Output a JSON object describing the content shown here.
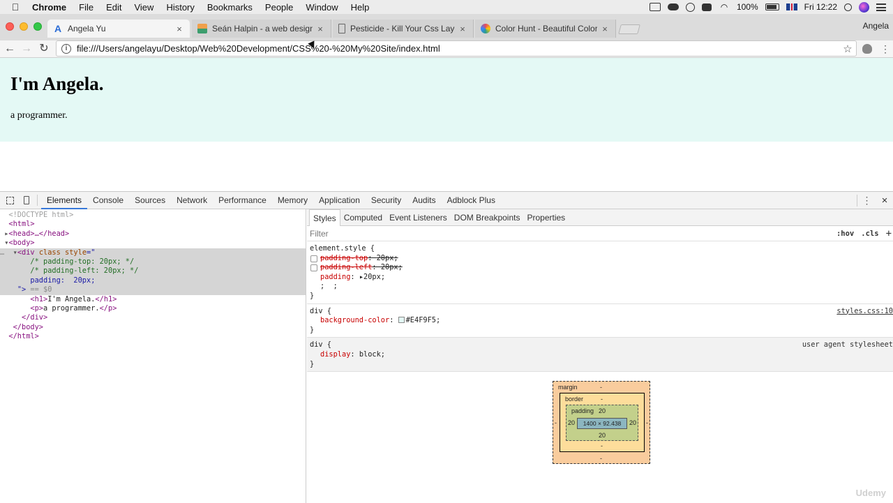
{
  "menubar": {
    "app": "Chrome",
    "items": [
      "File",
      "Edit",
      "View",
      "History",
      "Bookmarks",
      "People",
      "Window",
      "Help"
    ],
    "battery": "100%",
    "clock": "Fri 12:22"
  },
  "tabs": [
    {
      "title": "Angela Yu",
      "icon": "angela-favicon",
      "active": true
    },
    {
      "title": "Seán Halpin - a web designer a",
      "icon": "sean-favicon",
      "active": false
    },
    {
      "title": "Pesticide - Kill Your Css Layou",
      "icon": "page-icon",
      "active": false
    },
    {
      "title": "Color Hunt - Beautiful Color Pa",
      "icon": "colorhunt-favicon",
      "active": false
    }
  ],
  "profile": "Angela",
  "toolbar": {
    "url": "file:///Users/angelayu/Desktop/Web%20Development/CSS%20-%20My%20Site/index.html",
    "close_glyph": "×"
  },
  "page": {
    "heading": "I'm Angela.",
    "paragraph": "a programmer.",
    "bg_color": "#E4F9F5"
  },
  "devtools": {
    "tabs": [
      "Elements",
      "Console",
      "Sources",
      "Network",
      "Performance",
      "Memory",
      "Application",
      "Security",
      "Audits",
      "Adblock Plus"
    ],
    "active_tab": "Elements",
    "dom": {
      "doctype": "<!DOCTYPE html>",
      "html_open": "<html>",
      "head": "<head>…</head>",
      "body_open": "<body>",
      "div_open_tag": "<div",
      "div_attr_name": "class style",
      "div_attr_eq": "=\"",
      "comment1": "/* padding-top: 20px; */",
      "comment2": "/* padding-left: 20px; */",
      "style_line": "padding:  20px;",
      "close_quote": "\">",
      "dollar_zero": "== $0",
      "h1_open": "<h1>",
      "h1_text": "I'm Angela.",
      "h1_close": "</h1>",
      "p_open": "<p>",
      "p_text": "a programmer.",
      "p_close": "</p>",
      "div_close": "</div>",
      "body_close": "</body>",
      "html_close": "</html>"
    },
    "styles_tabs": [
      "Styles",
      "Computed",
      "Event Listeners",
      "DOM Breakpoints",
      "Properties"
    ],
    "filter_placeholder": "Filter",
    "filter_hov": ":hov",
    "filter_cls": ".cls",
    "filter_plus": "+",
    "rules": {
      "element_style": {
        "selector": "element.style {",
        "p1_name": "padding-top",
        "p1_val": "20px;",
        "p2_name": "padding-left",
        "p2_val": "20px;",
        "p3_name": "padding",
        "p3_val": "20px;",
        "p4": ";  ;",
        "close": "}"
      },
      "div_rule": {
        "selector": "div {",
        "source": "styles.css:10",
        "prop": "background-color",
        "val": "#E4F9F5;",
        "close": "}"
      },
      "ua_rule": {
        "selector": "div {",
        "source": "user agent stylesheet",
        "prop": "display",
        "val": "block;",
        "close": "}"
      }
    },
    "box_model": {
      "margin_label": "margin",
      "margin_value": "-",
      "margin_bottom": "-",
      "margin_left": "-",
      "margin_right": "-",
      "border_label": "border",
      "border_value": "-",
      "border_bottom": "-",
      "padding_label": "padding",
      "padding_top": "20",
      "padding_bottom": "20",
      "padding_left": "20",
      "padding_right": "20",
      "content": "1400 × 92.438"
    }
  },
  "watermark": "Udemy"
}
